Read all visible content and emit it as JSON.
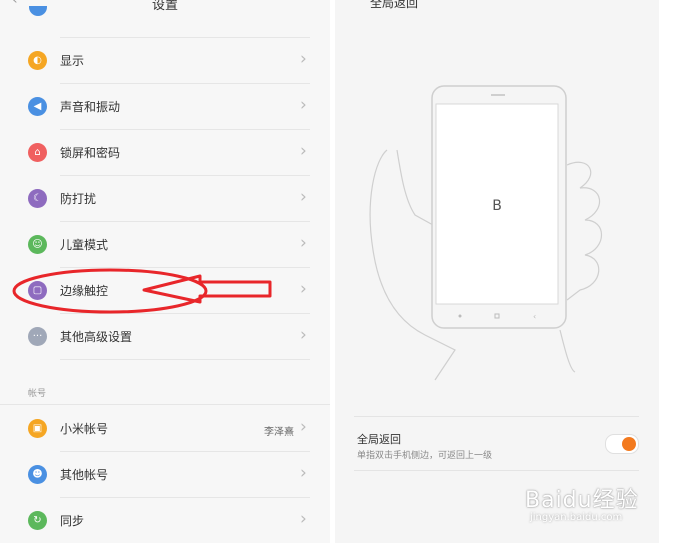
{
  "left": {
    "title": "设置",
    "items": [
      {
        "label": "显示",
        "color": "#f5a623",
        "icon": "sun-icon"
      },
      {
        "label": "声音和振动",
        "color": "#4a90e2",
        "icon": "speaker-icon"
      },
      {
        "label": "锁屏和密码",
        "color": "#f06060",
        "icon": "lock-icon"
      },
      {
        "label": "防打扰",
        "color": "#8e6bbf",
        "icon": "moon-icon"
      },
      {
        "label": "儿童模式",
        "color": "#5cb85c",
        "icon": "child-icon"
      },
      {
        "label": "边缘触控",
        "color": "#8e6bbf",
        "icon": "edge-icon"
      },
      {
        "label": "其他高级设置",
        "color": "#a0a8b8",
        "icon": "more-icon"
      }
    ],
    "section_label": "帐号",
    "account_items": [
      {
        "label": "小米帐号",
        "value": "李泽熹",
        "color": "#f5a623",
        "icon": "mi-icon"
      },
      {
        "label": "其他帐号",
        "color": "#4a90e2",
        "icon": "person-icon"
      },
      {
        "label": "同步",
        "color": "#5cb85c",
        "icon": "sync-icon"
      }
    ]
  },
  "right": {
    "title": "全局返回",
    "phone_letter": "B",
    "setting_label": "全局返回",
    "setting_desc": "单指双击手机侧边，可返回上一级",
    "toggle_on": true,
    "accent": "#f37a1f"
  },
  "watermark": {
    "brand": "Baidu经验",
    "url": "jingyan.baidu.com"
  }
}
